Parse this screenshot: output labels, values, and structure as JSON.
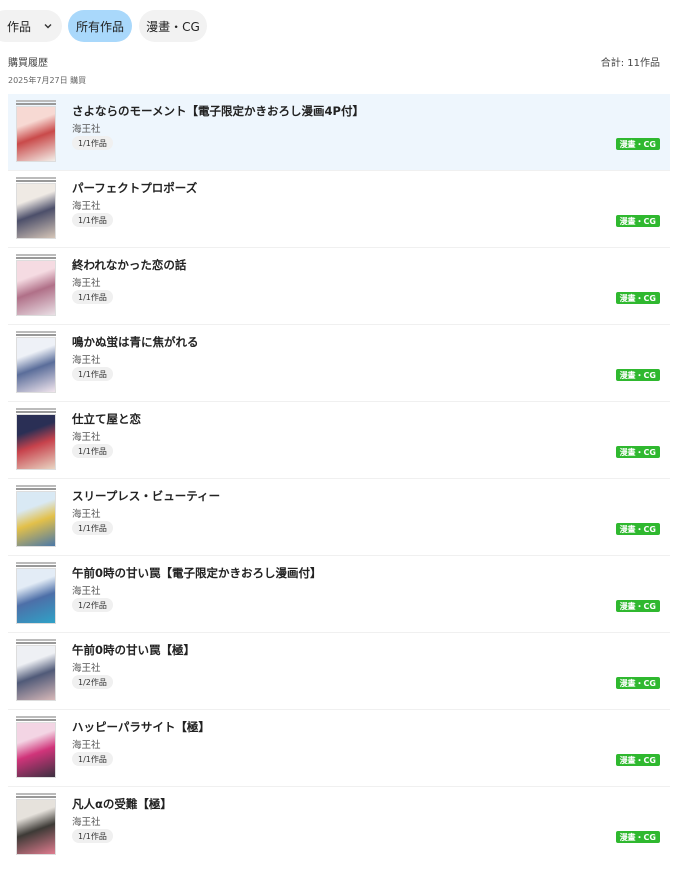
{
  "filters": {
    "work_label": "作品",
    "owned_label": "所有作品",
    "manga_label": "漫畫・CG"
  },
  "header": {
    "title": "購買履歴",
    "total": "合計: 11作品"
  },
  "date_label": "2025年7月27日 購買",
  "colors": {
    "selected_pill": "#a9d8fb",
    "tag_green": "#2fb82f",
    "selected_row": "#eef6fd"
  },
  "items": [
    {
      "title": "さよならのモーメント【電子限定かきおろし漫画4P付】",
      "publisher": "海王社",
      "count": "1/1作品",
      "tag": "漫畫・CG",
      "cover_colors": [
        "#f7d9d3",
        "#c94a4a",
        "#f3efe9"
      ]
    },
    {
      "title": "パーフェクトプロポーズ",
      "publisher": "海王社",
      "count": "1/1作品",
      "tag": "漫畫・CG",
      "cover_colors": [
        "#efeae4",
        "#4c4f6a",
        "#d6c6b8"
      ]
    },
    {
      "title": "終われなかった恋の話",
      "publisher": "海王社",
      "count": "1/1作品",
      "tag": "漫畫・CG",
      "cover_colors": [
        "#f5dbe2",
        "#b07088",
        "#eae0e6"
      ]
    },
    {
      "title": "鳴かぬ蛍は青に焦がれる",
      "publisher": "海王社",
      "count": "1/1作品",
      "tag": "漫畫・CG",
      "cover_colors": [
        "#eef1f7",
        "#5a6d9a",
        "#f2e6ee"
      ]
    },
    {
      "title": "仕立て屋と恋",
      "publisher": "海王社",
      "count": "1/1作品",
      "tag": "漫畫・CG",
      "cover_colors": [
        "#2a2f55",
        "#c7424c",
        "#e9d6c4"
      ]
    },
    {
      "title": "スリープレス・ビューティー",
      "publisher": "海王社",
      "count": "1/1作品",
      "tag": "漫畫・CG",
      "cover_colors": [
        "#d9e9f4",
        "#e2c04a",
        "#4a78a8"
      ]
    },
    {
      "title": "午前0時の甘い罠【電子限定かきおろし漫画付】",
      "publisher": "海王社",
      "count": "1/2作品",
      "tag": "漫畫・CG",
      "cover_colors": [
        "#e3ecf6",
        "#4d6fa8",
        "#2fa2c7"
      ]
    },
    {
      "title": "午前0時の甘い罠【極】",
      "publisher": "海王社",
      "count": "1/2作品",
      "tag": "漫畫・CG",
      "cover_colors": [
        "#eef0f4",
        "#505a78",
        "#d8b9b9"
      ]
    },
    {
      "title": "ハッピーパラサイト【極】",
      "publisher": "海王社",
      "count": "1/1作品",
      "tag": "漫畫・CG",
      "cover_colors": [
        "#f3d5e4",
        "#d0347a",
        "#3b3040"
      ]
    },
    {
      "title": "凡人αの受難【極】",
      "publisher": "海王社",
      "count": "1/1作品",
      "tag": "漫畫・CG",
      "cover_colors": [
        "#e6e2dc",
        "#3d3a36",
        "#e07c8f"
      ]
    }
  ]
}
